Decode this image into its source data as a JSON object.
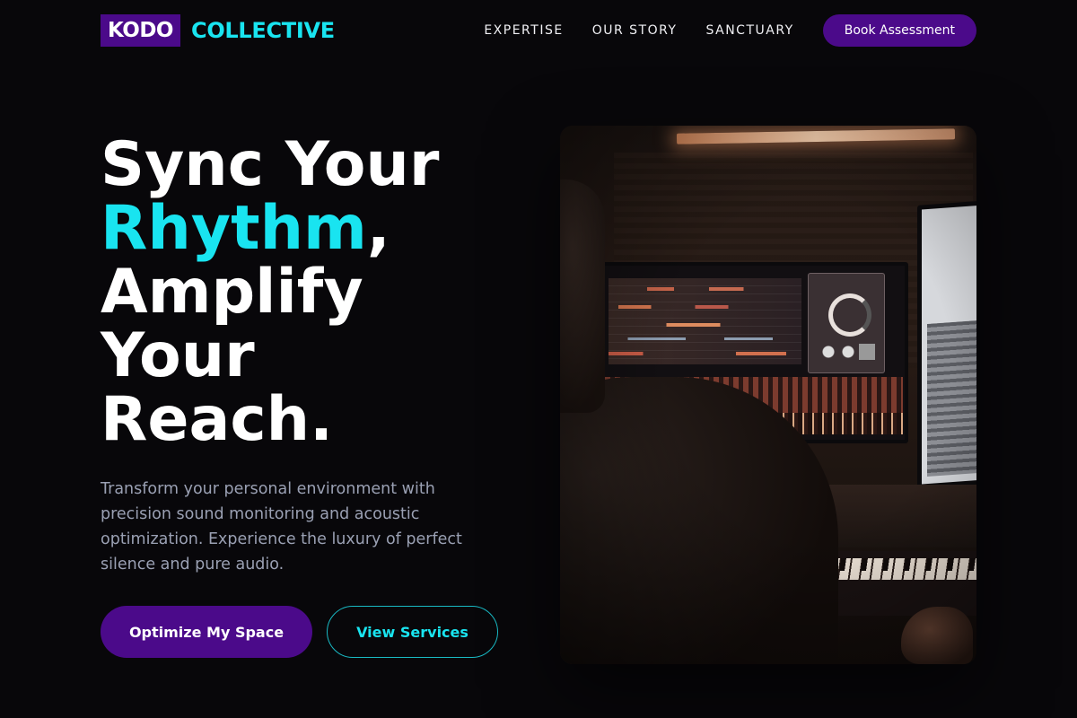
{
  "brand": {
    "logo_box": "KODO",
    "logo_word": "COLLECTIVE"
  },
  "nav": {
    "links": [
      "EXPERTISE",
      "OUR STORY",
      "SANCTUARY"
    ],
    "cta": "Book Assessment"
  },
  "hero": {
    "title_lines": [
      "Sync Your",
      "Rhythm",
      ",",
      "Amplify",
      "Your",
      "Reach."
    ],
    "description": "Transform your personal environment with precision sound monitoring and acoustic optimization. Experience the luxury of perfect silence and pure audio.",
    "primary_button": "Optimize My Space",
    "secondary_button": "View Services"
  },
  "colors": {
    "background": "#08070a",
    "brand_purple": "#4b0a8a",
    "accent_cyan": "#19e4f0",
    "body_text": "#9aa0b3"
  }
}
